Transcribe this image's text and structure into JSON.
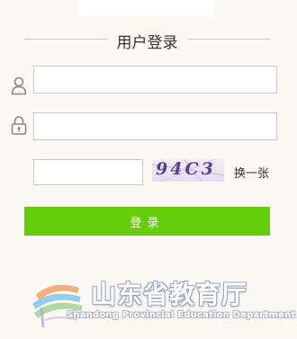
{
  "login": {
    "title": "用户登录",
    "username": {
      "value": "",
      "placeholder": "",
      "icon": "user-icon"
    },
    "password": {
      "value": "",
      "placeholder": "",
      "icon": "lock-icon"
    },
    "captcha": {
      "value": "",
      "placeholder": "",
      "image_text": "94C3",
      "refresh_label": "换一张"
    },
    "submit_label": "登录"
  },
  "footer": {
    "logo_cn": "山东省教育厅",
    "logo_en": "Shandong Provincial Education Department"
  },
  "colors": {
    "background": "#fbf9f2",
    "button": "#66cc0e",
    "border": "#c9c9c9"
  }
}
